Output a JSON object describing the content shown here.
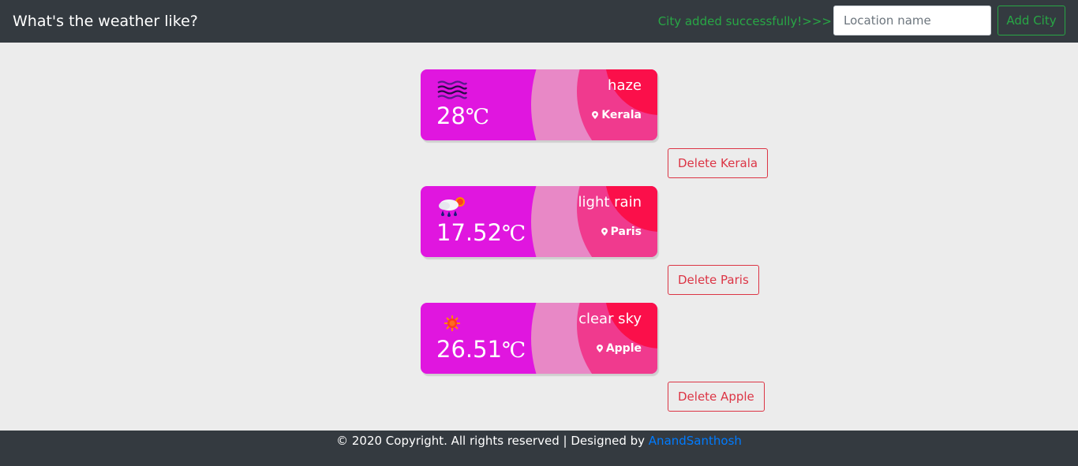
{
  "header": {
    "title": "What's the weather like?",
    "status_message": "City added successfully!>>>",
    "location_placeholder": "Location name",
    "add_button_label": "Add City"
  },
  "cards": [
    {
      "icon": "haze-icon",
      "temperature": "28",
      "unit": "℃",
      "description": "haze",
      "location": "Kerala",
      "delete_label": "Delete Kerala"
    },
    {
      "icon": "light-rain-icon",
      "temperature": "17.52",
      "unit": "℃",
      "description": "light rain",
      "location": "Paris",
      "delete_label": "Delete Paris"
    },
    {
      "icon": "clear-sky-icon",
      "temperature": "26.51",
      "unit": "℃",
      "description": "clear sky",
      "location": "Apple",
      "delete_label": "Delete Apple"
    }
  ],
  "footer": {
    "text": "© 2020 Copyright. All rights reserved | Designed by ",
    "author_link": "AnandSanthosh"
  },
  "colors": {
    "navbar": "#343a40",
    "card_base": "#e016df",
    "success": "#28a745",
    "danger": "#dc3545",
    "link": "#007bff"
  }
}
